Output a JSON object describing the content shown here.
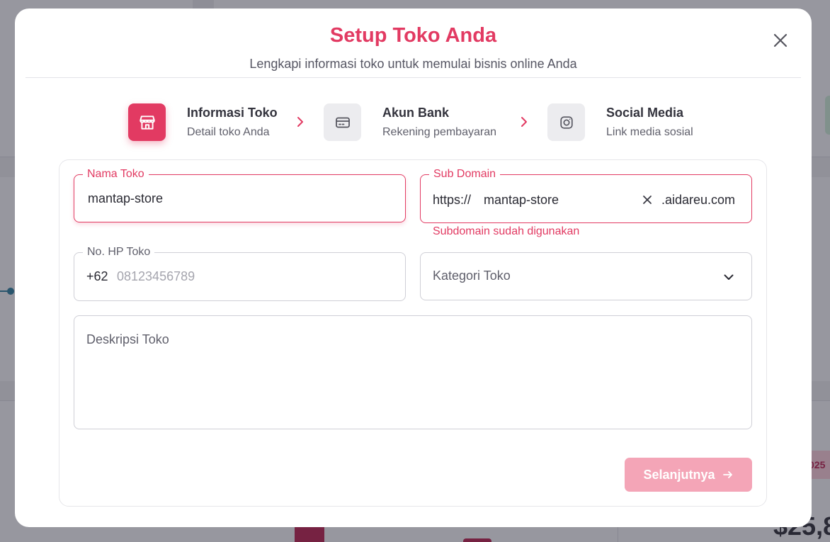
{
  "modal": {
    "title": "Setup Toko Anda",
    "subtitle": "Lengkapi informasi toko untuk memulai bisnis online Anda"
  },
  "steps": [
    {
      "title": "Informasi Toko",
      "desc": "Detail toko Anda",
      "icon": "store-icon",
      "active": true
    },
    {
      "title": "Akun Bank",
      "desc": "Rekening pembayaran",
      "icon": "credit-card-icon",
      "active": false
    },
    {
      "title": "Social Media",
      "desc": "Link media sosial",
      "icon": "instagram-icon",
      "active": false
    }
  ],
  "form": {
    "store_name": {
      "label": "Nama Toko",
      "value": "mantap-store"
    },
    "subdomain": {
      "label": "Sub Domain",
      "prefix": "https://",
      "value": "mantap-store",
      "suffix": ".aidareu.com",
      "error": "Subdomain sudah digunakan"
    },
    "phone": {
      "label": "No. HP Toko",
      "prefix": "+62",
      "placeholder": "08123456789"
    },
    "category": {
      "placeholder": "Kategori Toko"
    },
    "description": {
      "placeholder": "Deskripsi Toko"
    }
  },
  "next_button": {
    "label": "Selanjutnya"
  },
  "background": {
    "badge_text": "025",
    "amount_text": "$25,8"
  },
  "colors": {
    "accent": "#e23a62",
    "button_disabled": "#f4a5b7",
    "error": "#e23a62"
  }
}
